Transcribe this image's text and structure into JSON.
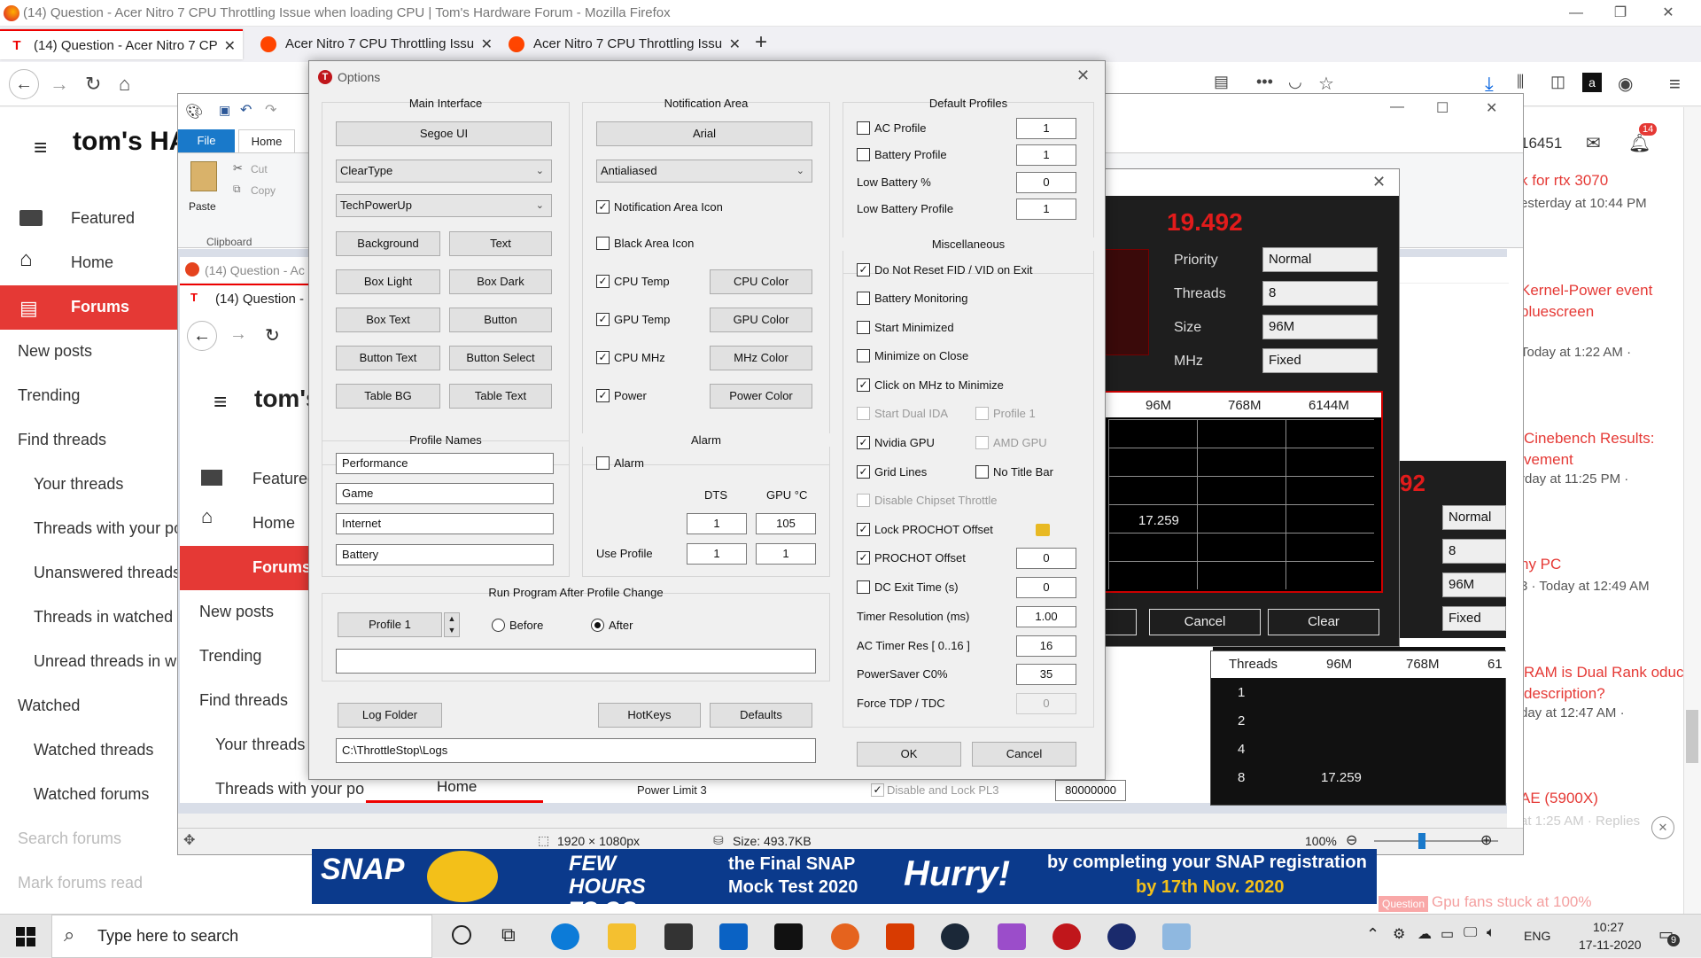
{
  "browser": {
    "window_title": "(14) Question - Acer Nitro 7 CPU Throttling Issue when loading CPU | Tom's Hardware Forum - Mozilla Firefox",
    "tabs": [
      {
        "label": "(14) Question - Acer Nitro 7 CP"
      },
      {
        "label": "Acer Nitro 7 CPU Throttling Issu"
      },
      {
        "label": "Acer Nitro 7 CPU Throttling Issu"
      }
    ],
    "new_tab": "+",
    "notif_count": "14",
    "points": "16451"
  },
  "forum": {
    "logo": "tom's HA",
    "nav": [
      {
        "label": "Featured"
      },
      {
        "label": "Home"
      },
      {
        "label": "Forums"
      },
      {
        "label": "New posts"
      },
      {
        "label": "Trending"
      },
      {
        "label": "Find threads"
      },
      {
        "label": "Your threads"
      },
      {
        "label": "Threads with your po"
      },
      {
        "label": "Unanswered threads"
      },
      {
        "label": "Threads in watched fo"
      },
      {
        "label": "Unread threads in wa"
      },
      {
        "label": "Watched"
      },
      {
        "label": "Watched threads"
      },
      {
        "label": "Watched forums"
      },
      {
        "label": "Search forums"
      },
      {
        "label": "Mark forums read"
      }
    ],
    "right": [
      {
        "title": "k for rtx 3070",
        "meta": "esterday at 10:44 PM"
      },
      {
        "title": "Kernel-Power event bluescreen",
        "meta": "Today at 1:22 AM ·"
      },
      {
        "title": "Cinebench Results: vement",
        "meta": "rday at 11:25 PM ·"
      },
      {
        "title": "ny PC",
        "meta": "3 · Today at 12:49 AM"
      },
      {
        "title": "RAM is Dual Rank oduct description?",
        "meta": "day at 12:47 AM ·"
      },
      {
        "title": "AE (5900X)",
        "meta": "at 1:25 AM · Replies"
      },
      {
        "title": "Gpu fans stuck at 100%",
        "meta": "Question"
      }
    ]
  },
  "paint": {
    "ribbon_tabs": [
      "File",
      "Home"
    ],
    "paste": "Paste",
    "cut": "Cut",
    "copy": "Copy",
    "clipboard": "Clipboard",
    "status_dims": "1920 × 1080px",
    "status_size": "Size: 493.7KB",
    "zoom": "100%"
  },
  "inner_browser": {
    "title": "(14) Question - Ac",
    "tab": "(14) Question -",
    "logo": "tom's",
    "nav": [
      {
        "label": "Featured"
      },
      {
        "label": "Home"
      },
      {
        "label": "Forums"
      },
      {
        "label": "New posts"
      },
      {
        "label": "Trending"
      },
      {
        "label": "Find threads"
      },
      {
        "label": "Your threads"
      },
      {
        "label": "Threads with your po"
      }
    ]
  },
  "options": {
    "title": "Options",
    "main_interface": {
      "label": "Main Interface",
      "font": "Segoe UI",
      "render": "ClearType",
      "theme": "TechPowerUp",
      "buttons": [
        [
          "Background",
          "Text"
        ],
        [
          "Box Light",
          "Box Dark"
        ],
        [
          "Box Text",
          "Button"
        ],
        [
          "Button Text",
          "Button Select"
        ],
        [
          "Table BG",
          "Table Text"
        ]
      ]
    },
    "notification": {
      "label": "Notification Area",
      "font": "Arial",
      "render": "Antialiased",
      "notif_icon": "Notification Area Icon",
      "black_icon": "Black Area Icon",
      "rows": [
        {
          "label": "CPU Temp",
          "btn": "CPU Color"
        },
        {
          "label": "GPU Temp",
          "btn": "GPU Color"
        },
        {
          "label": "CPU MHz",
          "btn": "MHz Color"
        },
        {
          "label": "Power",
          "btn": "Power Color"
        }
      ]
    },
    "profiles": {
      "label": "Default Profiles",
      "rows": [
        {
          "label": "AC Profile",
          "value": "1"
        },
        {
          "label": "Battery Profile",
          "value": "1"
        },
        {
          "label": "Low Battery %",
          "value": "0"
        },
        {
          "label": "Low Battery Profile",
          "value": "1"
        }
      ]
    },
    "misc": {
      "label": "Miscellaneous",
      "items": [
        "Do Not Reset FID / VID on Exit",
        "Battery Monitoring",
        "Start Minimized",
        "Minimize on Close",
        "Click on MHz to Minimize"
      ],
      "start_dual": "Start Dual IDA",
      "profile1": "Profile 1",
      "nvidia": "Nvidia GPU",
      "amd": "AMD GPU",
      "grid": "Grid Lines",
      "notitle": "No Title Bar",
      "chipset": "Disable Chipset Throttle",
      "lock_prochot": "Lock PROCHOT Offset",
      "prochot": "PROCHOT Offset",
      "prochot_val": "0",
      "dc_exit": "DC Exit Time (s)",
      "dc_val": "0",
      "fields": [
        {
          "label": "Timer Resolution (ms)",
          "value": "1.00"
        },
        {
          "label": "AC Timer Res [ 0..16 ]",
          "value": "16"
        },
        {
          "label": "PowerSaver C0%",
          "value": "35"
        },
        {
          "label": "Force TDP / TDC",
          "value": "0"
        }
      ]
    },
    "profile_names": {
      "label": "Profile Names",
      "names": [
        "Performance",
        "Game",
        "Internet",
        "Battery"
      ]
    },
    "alarm": {
      "label": "Alarm",
      "alarm": "Alarm",
      "dts": "DTS",
      "gpu": "GPU °C",
      "dts_val": "1",
      "gpu_val": "105",
      "use_profile": "Use Profile",
      "up1": "1",
      "up2": "1"
    },
    "run_program": {
      "label": "Run Program After Profile Change",
      "profile": "Profile 1",
      "before": "Before",
      "after": "After",
      "path": ""
    },
    "log_folder": "Log Folder",
    "hotkeys": "HotKeys",
    "defaults": "Defaults",
    "log_path": "C:\\ThrottleStop\\Logs",
    "ok": "OK",
    "cancel": "Cancel"
  },
  "throttlestop": {
    "freq": "19.492",
    "freq2": "92",
    "rows": [
      {
        "label": "Priority",
        "value": "Normal"
      },
      {
        "label": "Threads",
        "value": "8"
      },
      {
        "label": "Size",
        "value": "96M"
      },
      {
        "label": "MHz",
        "value": "Fixed"
      }
    ],
    "table_head": [
      "96M",
      "768M",
      "6144M"
    ],
    "value": "17.259",
    "cancel": "Cancel",
    "clear": "Clear",
    "second_vals": [
      "Normal",
      "8",
      "96M",
      "Fixed"
    ],
    "table2_head": [
      "Threads",
      "96M",
      "768M",
      "61"
    ],
    "table2_rows": [
      "1",
      "2",
      "4",
      "8"
    ],
    "power_limit": "Power Limit 3",
    "pl3": "Disable and Lock PL3",
    "pl3_val": "80000000"
  },
  "ad": {
    "brand": "SNAP",
    "l1": "FEW HOURS TO GO",
    "l2": "the Final SNAP Mock Test 2020",
    "l3": "Hurry!",
    "l4": "by completing your SNAP registration",
    "l5": "by 17th Nov. 2020"
  },
  "taskbar": {
    "search": "Type here to search",
    "lang": "ENG",
    "time": "10:27",
    "date": "17-11-2020",
    "badge": "9"
  },
  "colors": {
    "accent": "#e60000",
    "brand_red": "#d32f2f"
  }
}
